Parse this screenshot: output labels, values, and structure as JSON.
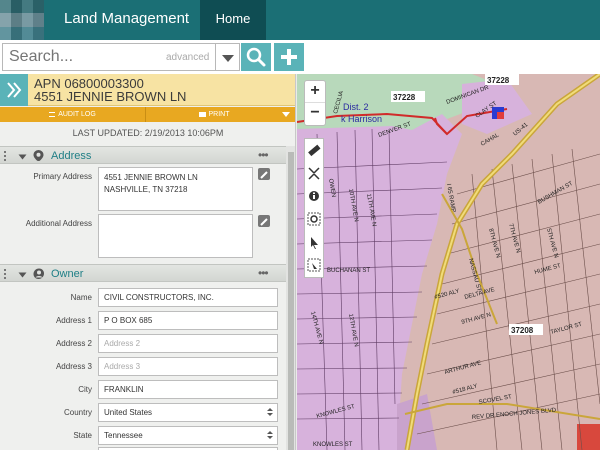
{
  "header": {
    "app_title": "Land Management",
    "home_tab": "Home"
  },
  "search": {
    "placeholder": "Search...",
    "advanced_label": "advanced"
  },
  "parcel": {
    "apn": "APN 06800003300",
    "address": "4551 JENNIE BROWN LN",
    "audit_log": "AUDIT LOG",
    "print": "PRINT",
    "last_updated": "LAST UPDATED: 2/19/2013 10:06PM"
  },
  "address_section": {
    "title": "Address",
    "more": "•••",
    "primary_label": "Primary Address",
    "primary_line1": "4551 JENNIE BROWN LN",
    "primary_line2": "NASHVILLE, TN 37218",
    "additional_label": "Additional Address",
    "additional_value": ""
  },
  "owner_section": {
    "title": "Owner",
    "more": "•••",
    "fields": [
      {
        "label": "Name",
        "value": "CIVIL CONSTRUCTORS, INC.",
        "placeholder": ""
      },
      {
        "label": "Address 1",
        "value": "P O BOX 685",
        "placeholder": ""
      },
      {
        "label": "Address 2",
        "value": "",
        "placeholder": "Address 2"
      },
      {
        "label": "Address 3",
        "value": "",
        "placeholder": "Address 3"
      },
      {
        "label": "City",
        "value": "FRANKLIN",
        "placeholder": ""
      },
      {
        "label": "Country",
        "value": "United States",
        "placeholder": ""
      },
      {
        "label": "State",
        "value": "Tennessee",
        "placeholder": ""
      }
    ]
  },
  "map": {
    "zoom_in": "+",
    "zoom_out": "−",
    "labels": {
      "zip_37228_a": "37228",
      "zip_37228_b": "37228",
      "zip_37208": "37208",
      "dist": "Dist. 2",
      "council": "k Harrison",
      "dominican": "DOMINICAN DR",
      "clay_st": "CLAY ST",
      "delta_ave": "DELTA AVE",
      "hume_st": "HUME ST",
      "taylor_st": "TAYLOR ST",
      "ave_9th": "9TH AVE N",
      "ave_14th": "14TH AVE N",
      "ave_10th": "10TH AVE N",
      "ave_11th": "11TH AVE N",
      "ave_12th": "12TH AVE N",
      "owen": "OWEN",
      "arthur": "ARTHUR AVE",
      "scovel": "SCOVEL ST",
      "knowles": "KNOWLES ST",
      "rev_dr": "REV DR ENOCH JONES BLVD",
      "bushman": "BUSHMAN ST",
      "nassau": "NASSAU ST",
      "alley_518": "#518 ALY",
      "alley_520": "#520 ALY",
      "ave_7th": "7TH AVE N",
      "ave_5th": "5TH AVE N",
      "ave_8th": "8TH AVE N",
      "cecilia": "CECILIA",
      "i65": "I 65 RAMP",
      "buchanan": "BUCHANAN ST",
      "denver": "DENVER ST",
      "cahal": "CAHAL",
      "hwy": "US-41",
      "knowles_st": "KNOWLES ST"
    }
  },
  "colors": {
    "topbar": "#1b6f75",
    "accent": "#5ab3b8",
    "apn_bg": "#f7e3a3",
    "action_bar": "#e8a821",
    "map_purple": "#d8b4dc",
    "map_pink": "#d8b8b4",
    "map_green": "#b5d8b5"
  }
}
